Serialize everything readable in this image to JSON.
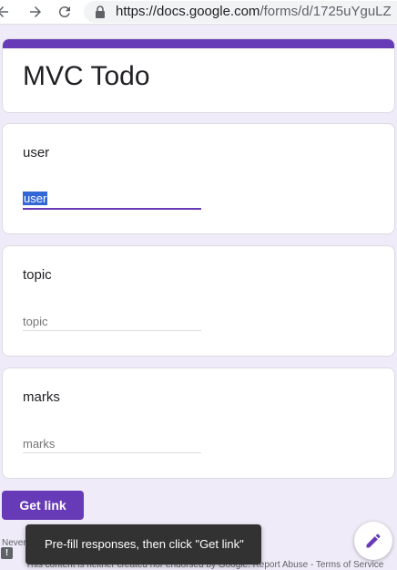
{
  "browser": {
    "url_host": "https://docs.google.com",
    "url_path": "/forms/d/1725uYguLZ"
  },
  "form": {
    "title": "MVC Todo",
    "questions": [
      {
        "title": "user",
        "value": "user",
        "placeholder": "user"
      },
      {
        "title": "topic",
        "value": "",
        "placeholder": "topic"
      },
      {
        "title": "marks",
        "value": "",
        "placeholder": "marks"
      }
    ],
    "submit_label": "Get link",
    "footer_partial": "Never",
    "disclaimer": "This content is neither created nor endorsed by Google. Report Abuse - Terms of Service"
  },
  "snackbar": {
    "message": "Pre-fill responses, then click \"Get link\""
  },
  "icons": {
    "back": "back-arrow-icon",
    "forward": "forward-arrow-icon",
    "reload": "reload-icon",
    "lock": "lock-icon",
    "edit": "pencil-icon",
    "report": "exclamation-icon"
  },
  "colors": {
    "accent": "#673ab7",
    "background": "#f0ebf8",
    "selection": "#3367d6",
    "snackbar": "#323232"
  }
}
